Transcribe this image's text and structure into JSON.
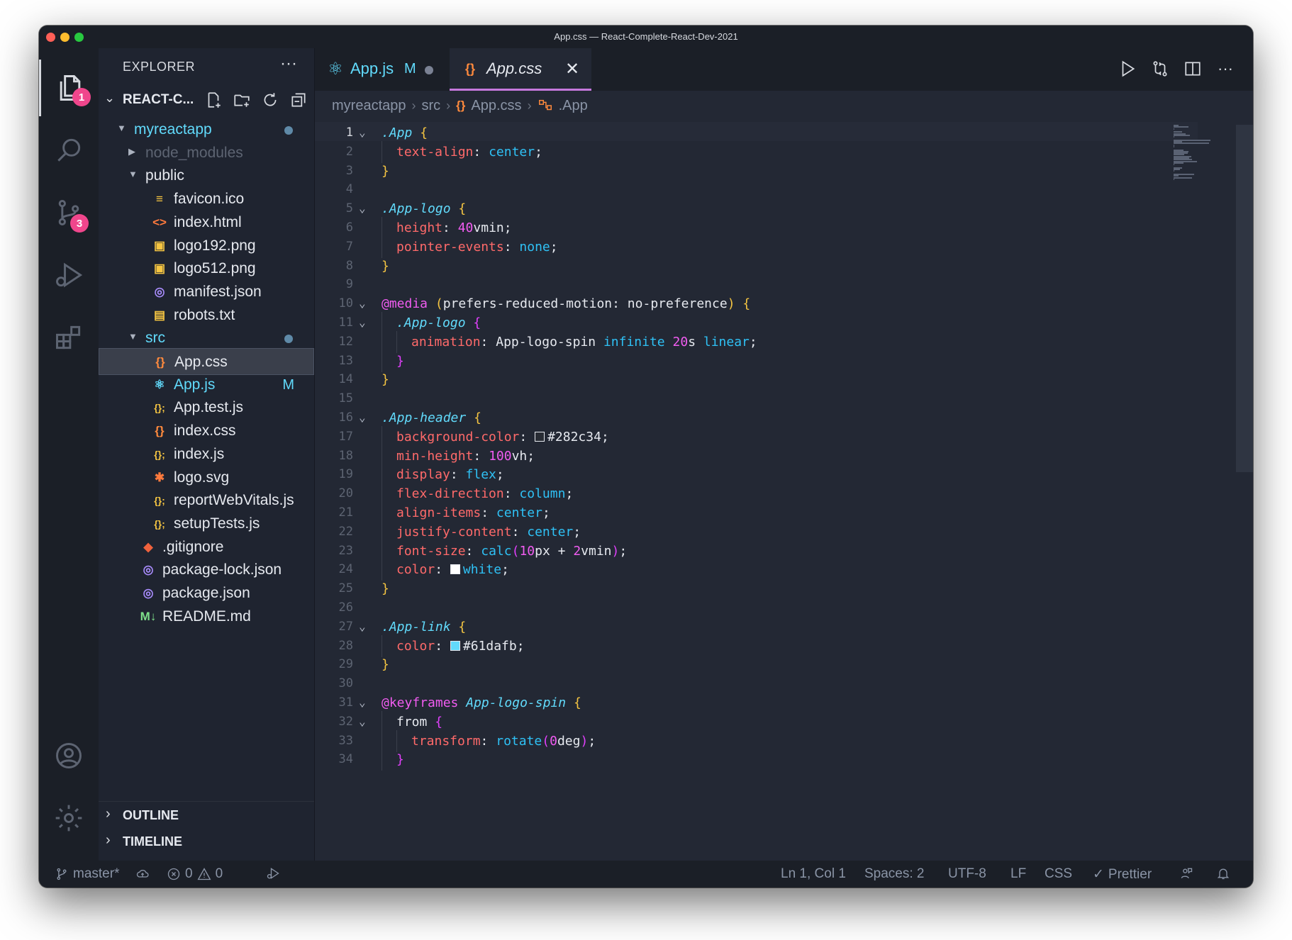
{
  "window": {
    "title": "App.css — React-Complete-React-Dev-2021"
  },
  "activity_bar": {
    "explorer_badge": "1",
    "scm_badge": "3"
  },
  "sidebar": {
    "title": "EXPLORER",
    "more": "···",
    "project": "REACT-C...",
    "tree": [
      {
        "label": "myreactapp",
        "type": "folder-open",
        "depth": 0,
        "dot": true,
        "color": "#61dafb"
      },
      {
        "label": "node_modules",
        "type": "folder",
        "depth": 1,
        "dim": true
      },
      {
        "label": "public",
        "type": "folder-open",
        "depth": 1
      },
      {
        "label": "favicon.ico",
        "type": "file",
        "depth": 2,
        "icon": "ico-icon",
        "glyph": "≡",
        "iconColor": "#f5c542"
      },
      {
        "label": "index.html",
        "type": "file",
        "depth": 2,
        "icon": "html-icon",
        "glyph": "<>",
        "iconColor": "#ff7a3d"
      },
      {
        "label": "logo192.png",
        "type": "file",
        "depth": 2,
        "icon": "image-icon",
        "glyph": "▣",
        "iconColor": "#f5c542"
      },
      {
        "label": "logo512.png",
        "type": "file",
        "depth": 2,
        "icon": "image-icon",
        "glyph": "▣",
        "iconColor": "#f5c542"
      },
      {
        "label": "manifest.json",
        "type": "file",
        "depth": 2,
        "icon": "json-icon",
        "glyph": "◎",
        "iconColor": "#a78bfa"
      },
      {
        "label": "robots.txt",
        "type": "file",
        "depth": 2,
        "icon": "text-file-icon",
        "glyph": "▤",
        "iconColor": "#f5c542"
      },
      {
        "label": "src",
        "type": "folder-open",
        "depth": 1,
        "dot": true,
        "color": "#61dafb"
      },
      {
        "label": "App.css",
        "type": "file",
        "depth": 2,
        "icon": "css-icon",
        "glyph": "{}",
        "iconColor": "#ff8a3d",
        "selected": true
      },
      {
        "label": "App.js",
        "type": "file",
        "depth": 2,
        "icon": "react-icon",
        "glyph": "⚛",
        "iconColor": "#61dafb",
        "badge": "M",
        "color": "#61dafb"
      },
      {
        "label": "App.test.js",
        "type": "file",
        "depth": 2,
        "icon": "js-icon",
        "glyph": "{};",
        "iconColor": "#f5c542"
      },
      {
        "label": "index.css",
        "type": "file",
        "depth": 2,
        "icon": "css-icon",
        "glyph": "{}",
        "iconColor": "#ff8a3d"
      },
      {
        "label": "index.js",
        "type": "file",
        "depth": 2,
        "icon": "js-icon",
        "glyph": "{};",
        "iconColor": "#f5c542"
      },
      {
        "label": "logo.svg",
        "type": "file",
        "depth": 2,
        "icon": "svg-icon",
        "glyph": "✱",
        "iconColor": "#ff7a3d"
      },
      {
        "label": "reportWebVitals.js",
        "type": "file",
        "depth": 2,
        "icon": "js-icon",
        "glyph": "{};",
        "iconColor": "#f5c542"
      },
      {
        "label": "setupTests.js",
        "type": "file",
        "depth": 2,
        "icon": "js-icon",
        "glyph": "{};",
        "iconColor": "#f5c542"
      },
      {
        "label": ".gitignore",
        "type": "file",
        "depth": 1,
        "icon": "git-icon",
        "glyph": "◆",
        "iconColor": "#f0623d"
      },
      {
        "label": "package-lock.json",
        "type": "file",
        "depth": 1,
        "icon": "json-icon",
        "glyph": "◎",
        "iconColor": "#a78bfa"
      },
      {
        "label": "package.json",
        "type": "file",
        "depth": 1,
        "icon": "json-icon",
        "glyph": "◎",
        "iconColor": "#a78bfa"
      },
      {
        "label": "README.md",
        "type": "file",
        "depth": 1,
        "icon": "markdown-icon",
        "glyph": "M↓",
        "iconColor": "#7ee08a"
      }
    ],
    "outline": "OUTLINE",
    "timeline": "TIMELINE"
  },
  "tabs": [
    {
      "label": "App.js",
      "modified": "M",
      "active": false
    },
    {
      "label": "App.css",
      "active": true
    }
  ],
  "breadcrumb": [
    "myreactapp",
    "src",
    "App.css",
    ".App"
  ],
  "code": [
    [
      [
        "sel",
        ".App"
      ],
      [
        "t",
        " "
      ],
      [
        "by",
        "{"
      ]
    ],
    [
      [
        "g1"
      ],
      [
        "prop",
        "text-align"
      ],
      [
        "p",
        ": "
      ],
      [
        "val",
        "center"
      ],
      [
        "p",
        ";"
      ]
    ],
    [
      [
        "by",
        "}"
      ]
    ],
    [],
    [
      [
        "sel",
        ".App-logo"
      ],
      [
        "t",
        " "
      ],
      [
        "by",
        "{"
      ]
    ],
    [
      [
        "g1"
      ],
      [
        "prop",
        "height"
      ],
      [
        "p",
        ": "
      ],
      [
        "num",
        "40"
      ],
      [
        "t",
        "vmin"
      ],
      [
        "p",
        ";"
      ]
    ],
    [
      [
        "g1"
      ],
      [
        "prop",
        "pointer-events"
      ],
      [
        "p",
        ": "
      ],
      [
        "val",
        "none"
      ],
      [
        "p",
        ";"
      ]
    ],
    [
      [
        "by",
        "}"
      ]
    ],
    [],
    [
      [
        "at",
        "@media"
      ],
      [
        "t",
        " "
      ],
      [
        "by",
        "("
      ],
      [
        "t",
        "prefers-reduced-motion: no-preference"
      ],
      [
        "by",
        ")"
      ],
      [
        "t",
        " "
      ],
      [
        "by",
        "{"
      ]
    ],
    [
      [
        "g1"
      ],
      [
        "sel",
        ".App-logo"
      ],
      [
        "t",
        " "
      ],
      [
        "bp",
        "{"
      ]
    ],
    [
      [
        "g1"
      ],
      [
        "g2"
      ],
      [
        "prop",
        "animation"
      ],
      [
        "p",
        ": "
      ],
      [
        "t",
        "App-logo-spin "
      ],
      [
        "val",
        "infinite "
      ],
      [
        "num",
        "20"
      ],
      [
        "t",
        "s "
      ],
      [
        "val",
        "linear"
      ],
      [
        "p",
        ";"
      ]
    ],
    [
      [
        "g1"
      ],
      [
        "bp",
        "}"
      ]
    ],
    [
      [
        "by",
        "}"
      ]
    ],
    [],
    [
      [
        "sel",
        ".App-header"
      ],
      [
        "t",
        " "
      ],
      [
        "by",
        "{"
      ]
    ],
    [
      [
        "g1"
      ],
      [
        "prop",
        "background-color"
      ],
      [
        "p",
        ": "
      ],
      [
        "sw",
        "#282c34"
      ],
      [
        "t",
        "#282c34"
      ],
      [
        "p",
        ";"
      ]
    ],
    [
      [
        "g1"
      ],
      [
        "prop",
        "min-height"
      ],
      [
        "p",
        ": "
      ],
      [
        "num",
        "100"
      ],
      [
        "t",
        "vh"
      ],
      [
        "p",
        ";"
      ]
    ],
    [
      [
        "g1"
      ],
      [
        "prop",
        "display"
      ],
      [
        "p",
        ": "
      ],
      [
        "val",
        "flex"
      ],
      [
        "p",
        ";"
      ]
    ],
    [
      [
        "g1"
      ],
      [
        "prop",
        "flex-direction"
      ],
      [
        "p",
        ": "
      ],
      [
        "val",
        "column"
      ],
      [
        "p",
        ";"
      ]
    ],
    [
      [
        "g1"
      ],
      [
        "prop",
        "align-items"
      ],
      [
        "p",
        ": "
      ],
      [
        "val",
        "center"
      ],
      [
        "p",
        ";"
      ]
    ],
    [
      [
        "g1"
      ],
      [
        "prop",
        "justify-content"
      ],
      [
        "p",
        ": "
      ],
      [
        "val",
        "center"
      ],
      [
        "p",
        ";"
      ]
    ],
    [
      [
        "g1"
      ],
      [
        "prop",
        "font-size"
      ],
      [
        "p",
        ": "
      ],
      [
        "val",
        "calc"
      ],
      [
        "bp",
        "("
      ],
      [
        "num",
        "10"
      ],
      [
        "t",
        "px + "
      ],
      [
        "num",
        "2"
      ],
      [
        "t",
        "vmin"
      ],
      [
        "bp",
        ")"
      ],
      [
        "p",
        ";"
      ]
    ],
    [
      [
        "g1"
      ],
      [
        "prop",
        "color"
      ],
      [
        "p",
        ": "
      ],
      [
        "sw",
        "#ffffff"
      ],
      [
        "val",
        "white"
      ],
      [
        "p",
        ";"
      ]
    ],
    [
      [
        "by",
        "}"
      ]
    ],
    [],
    [
      [
        "sel",
        ".App-link"
      ],
      [
        "t",
        " "
      ],
      [
        "by",
        "{"
      ]
    ],
    [
      [
        "g1"
      ],
      [
        "prop",
        "color"
      ],
      [
        "p",
        ": "
      ],
      [
        "sw",
        "#61dafb"
      ],
      [
        "t",
        "#61dafb"
      ],
      [
        "p",
        ";"
      ]
    ],
    [
      [
        "by",
        "}"
      ]
    ],
    [],
    [
      [
        "at",
        "@keyframes"
      ],
      [
        "t",
        " "
      ],
      [
        "sel",
        "App-logo-spin"
      ],
      [
        "t",
        " "
      ],
      [
        "by",
        "{"
      ]
    ],
    [
      [
        "g1"
      ],
      [
        "t",
        "from "
      ],
      [
        "bp",
        "{"
      ]
    ],
    [
      [
        "g1"
      ],
      [
        "g2"
      ],
      [
        "prop",
        "transform"
      ],
      [
        "p",
        ": "
      ],
      [
        "val",
        "rotate"
      ],
      [
        "bp",
        "("
      ],
      [
        "num",
        "0"
      ],
      [
        "t",
        "deg"
      ],
      [
        "bp",
        ")"
      ],
      [
        "p",
        ";"
      ]
    ],
    [
      [
        "g1"
      ],
      [
        "bp",
        "}"
      ]
    ]
  ],
  "folds": [
    1,
    5,
    10,
    11,
    16,
    27,
    31,
    32
  ],
  "status": {
    "branch": "master*",
    "errors": "0",
    "warnings": "0",
    "position": "Ln 1, Col 1",
    "spaces": "Spaces: 2",
    "encoding": "UTF-8",
    "eol": "LF",
    "language": "CSS",
    "formatter": "Prettier"
  }
}
